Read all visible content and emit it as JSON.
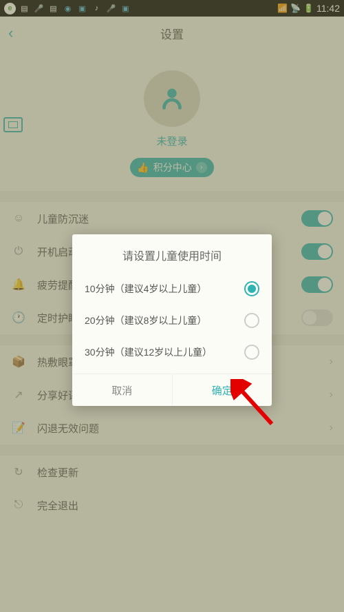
{
  "status": {
    "time": "11:42"
  },
  "nav": {
    "title": "设置"
  },
  "profile": {
    "login_status": "未登录",
    "points_label": "积分中心"
  },
  "settings": {
    "items": [
      {
        "label": "儿童防沉迷"
      },
      {
        "label": "开机启动"
      },
      {
        "label": "疲劳提醒"
      },
      {
        "label": "定时护眼"
      },
      {
        "label": "热敷眼罩"
      },
      {
        "label": "分享好评"
      },
      {
        "label": "闪退无效问题"
      },
      {
        "label": "检查更新"
      },
      {
        "label": "完全退出"
      }
    ]
  },
  "dialog": {
    "title": "请设置儿童使用时间",
    "options": [
      {
        "label": "10分钟（建议4岁以上儿童）"
      },
      {
        "label": "20分钟（建议8岁以上儿童）"
      },
      {
        "label": "30分钟（建议12岁以上儿童）"
      }
    ],
    "cancel": "取消",
    "confirm": "确定"
  }
}
